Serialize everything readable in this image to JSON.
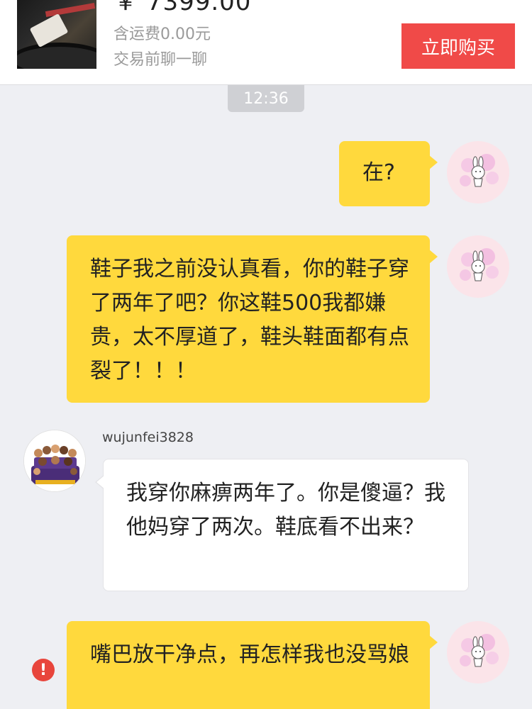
{
  "product": {
    "price": "￥ 7399.00",
    "shipping": "含运费0.00元",
    "chat_prompt": "交易前聊一聊",
    "buy_label": "立即购买",
    "buy_color": "#f04a48"
  },
  "chat": {
    "timestamp": "12:36",
    "messages": [
      {
        "sender": "me",
        "text": "在?"
      },
      {
        "sender": "me",
        "text": "鞋子我之前没认真看，你的鞋子穿了两年了吧？你这鞋500我都嫌贵，太不厚道了，鞋头鞋面都有点裂了！！！"
      },
      {
        "sender": "other",
        "username": "wujunfei3828",
        "text": "我穿你麻痹两年了。你是傻逼？我他妈穿了两次。鞋底看不出来？"
      },
      {
        "sender": "me",
        "text": "嘴巴放干净点，再怎样我也没骂娘",
        "status_icon": "error-icon",
        "status_symbol": "!"
      }
    ]
  },
  "colors": {
    "my_bubble": "#ffd93d",
    "their_bubble": "#ffffff",
    "background": "#eeeff3",
    "error": "#e8453c"
  }
}
